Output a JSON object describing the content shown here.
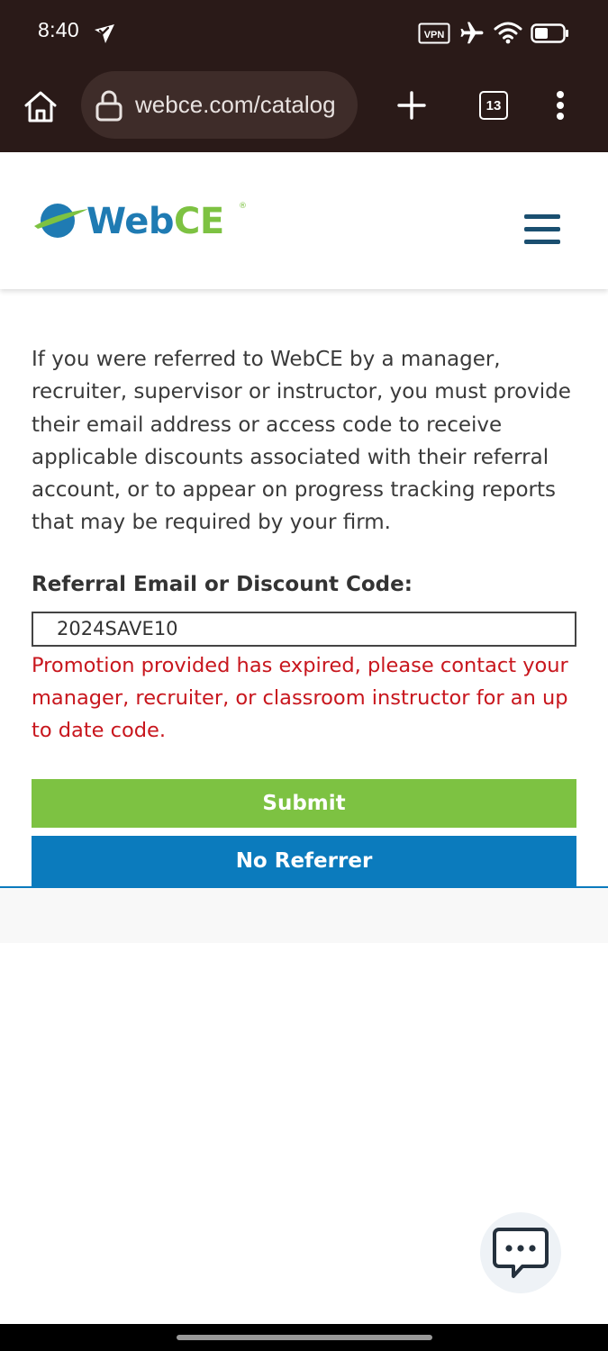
{
  "status_bar": {
    "time": "8:40",
    "vpn_label": "VPN",
    "icons": [
      "location-check-icon",
      "vpn-icon",
      "airplane-icon",
      "wifi-icon",
      "battery-icon"
    ]
  },
  "browser": {
    "url": "webce.com/catalog",
    "tab_count": "13",
    "icons": [
      "home-icon",
      "lock-icon",
      "new-tab-icon",
      "tabs-icon",
      "more-menu-icon"
    ]
  },
  "header": {
    "logo_web": "Web",
    "logo_ce": "CE",
    "logo_mark": "®",
    "menu_icon": "hamburger-menu-icon"
  },
  "main": {
    "intro_text": "If you were referred to WebCE by a manager, recruiter, supervisor or instructor, you must provide their email address or access code to receive applicable discounts associated with their referral account, or to appear on progress tracking reports that may be required by your firm.",
    "field_label": "Referral Email or Discount Code:",
    "field_value": "2024SAVE10",
    "error_message": "Promotion provided has expired, please contact your manager, recruiter, or classroom instructor for an up to date code.",
    "submit_label": "Submit",
    "no_referrer_label": "No Referrer"
  },
  "colors": {
    "brand_blue": "#0b7bbd",
    "brand_green": "#7dc242",
    "error_red": "#c8161d",
    "browser_chrome": "#2a1a18"
  },
  "chat": {
    "icon": "chat-bubble-icon"
  }
}
